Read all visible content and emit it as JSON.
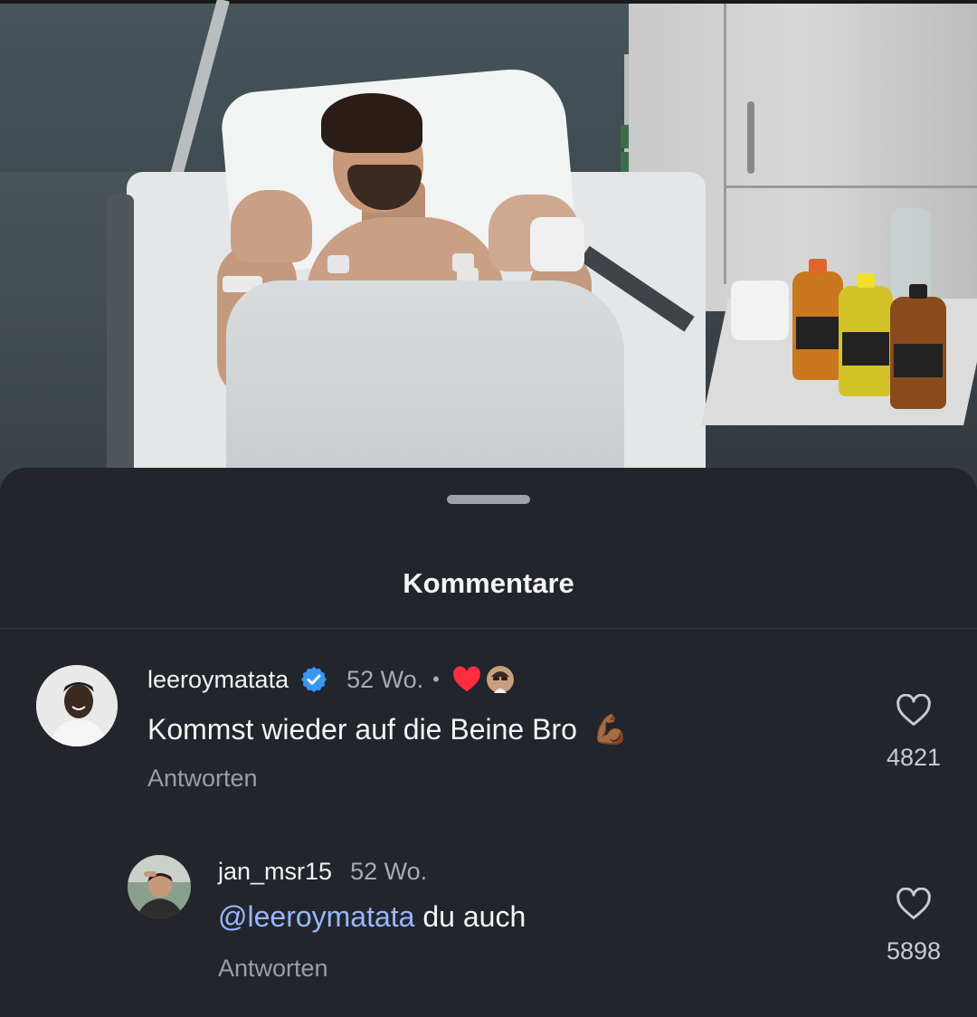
{
  "sheet": {
    "title": "Kommentare"
  },
  "comments": [
    {
      "username": "leeroymatata",
      "verified": true,
      "time": "52 Wo.",
      "separator": "•",
      "text": "Kommst wieder auf die Beine Bro",
      "emoji": "💪🏾",
      "reply_label": "Antworten",
      "likes": "4821",
      "liked_by_creator": true
    },
    {
      "username": "jan_msr15",
      "verified": false,
      "time": "52 Wo.",
      "mention": "@leeroymatata",
      "text": " du auch",
      "reply_label": "Antworten",
      "likes": "5898"
    }
  ],
  "icons": {
    "verified": "verified-badge-icon",
    "creator_like": "heart-icon",
    "like": "heart-outline-icon",
    "drag": "drag-handle"
  },
  "colors": {
    "background": "#22252b",
    "verified": "#3897f0",
    "heart": "#ff2d3d",
    "mention": "#98b7ff"
  }
}
